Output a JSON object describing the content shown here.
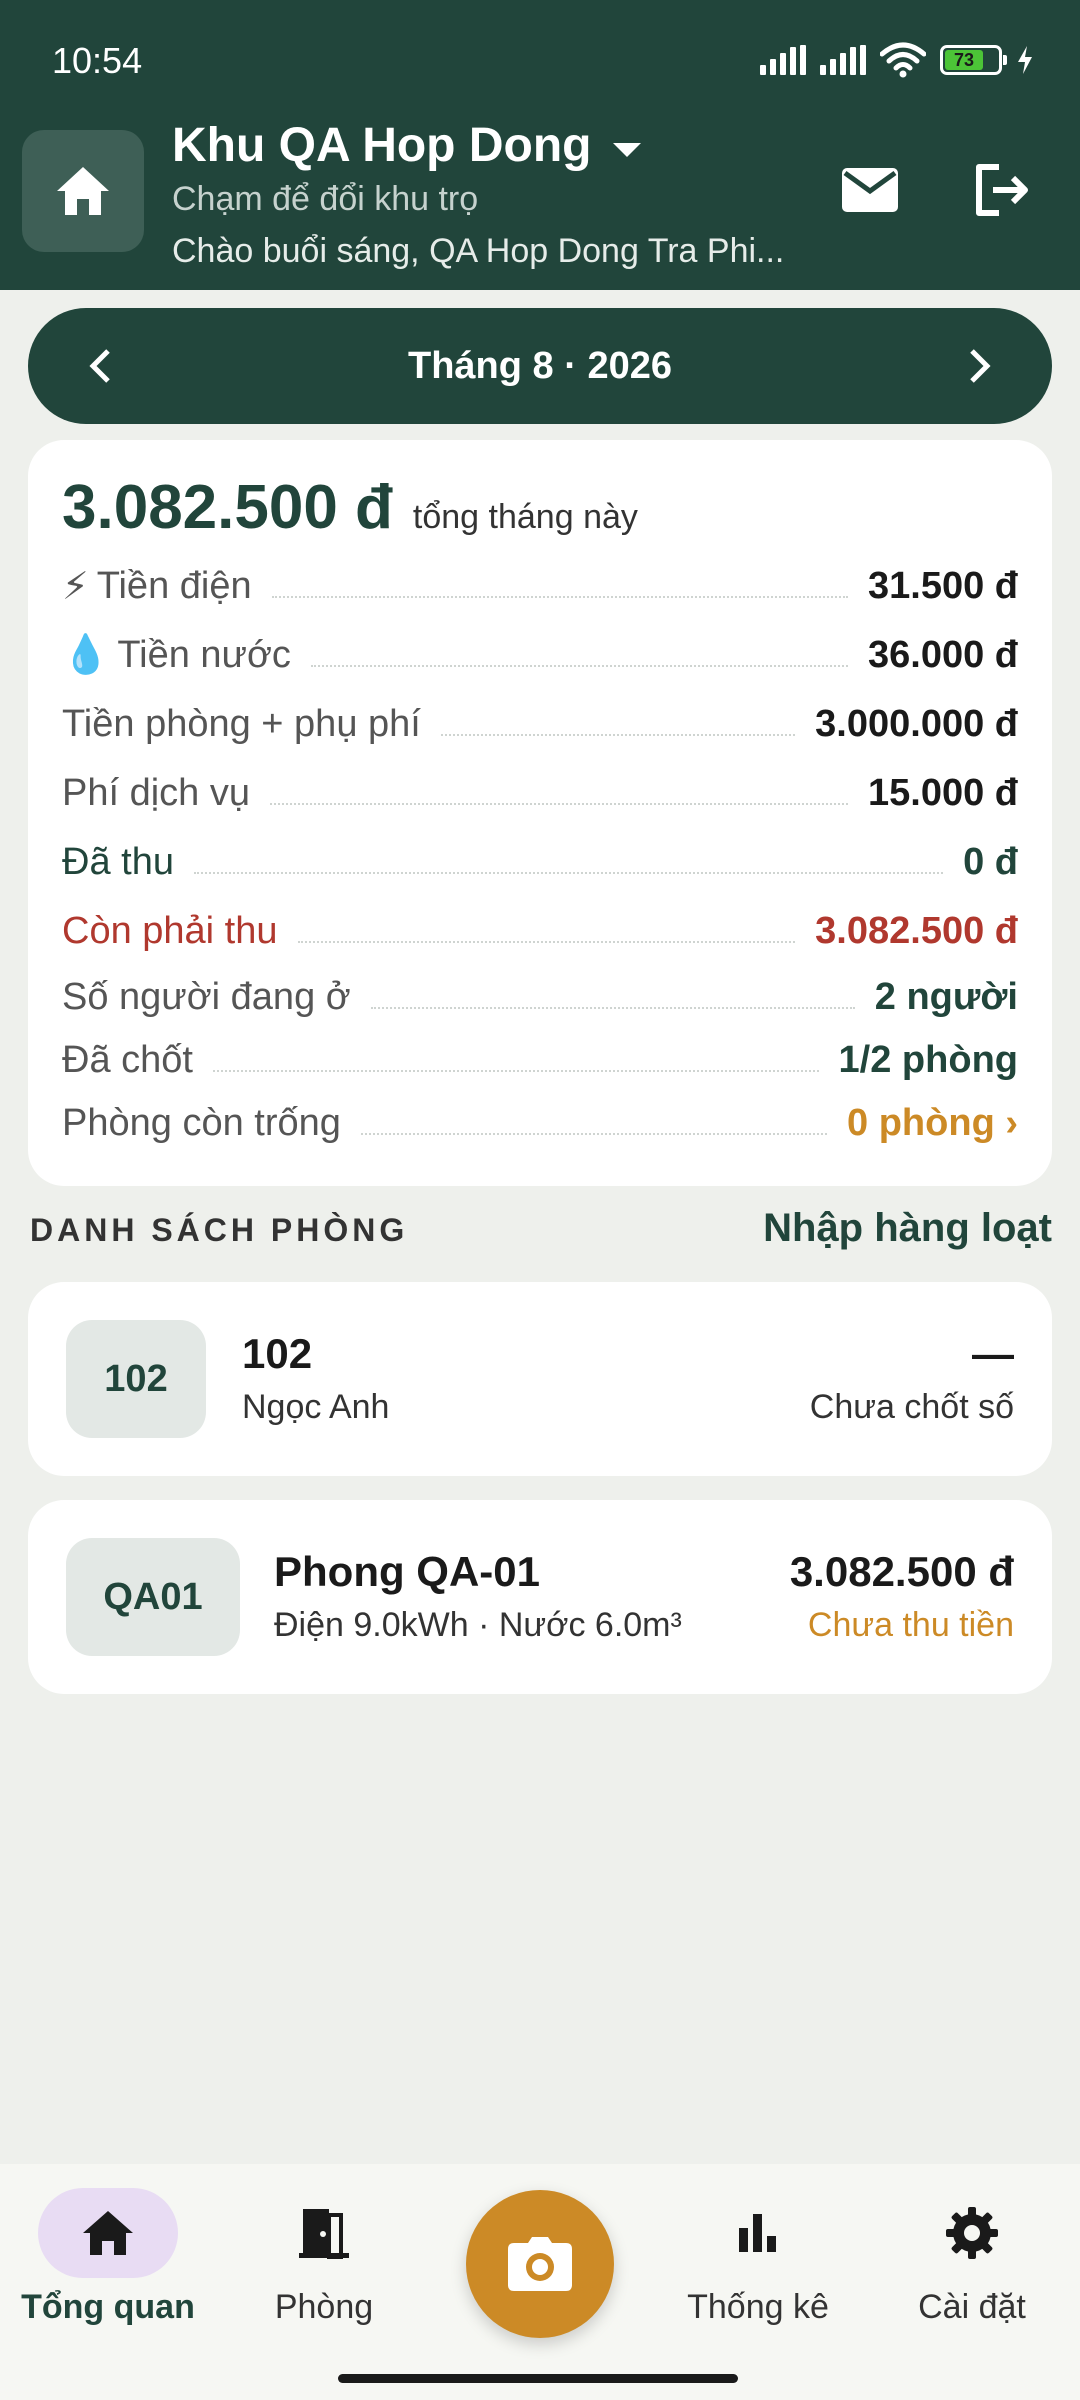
{
  "status_bar": {
    "time": "10:54",
    "battery": "73"
  },
  "header": {
    "title": "Khu QA Hop Dong",
    "subtitle": "Chạm để đổi khu trọ",
    "greeting": "Chào buổi sáng, QA Hop Dong Tra Phi..."
  },
  "month": {
    "label": "Tháng 8 · 2026"
  },
  "summary": {
    "total": "3.082.500 đ",
    "total_caption": "tổng tháng này",
    "rows": [
      {
        "icon": "⚡",
        "label": "Tiền điện",
        "value": "31.500 đ"
      },
      {
        "icon": "💧",
        "label": "Tiền nước",
        "value": "36.000 đ"
      },
      {
        "label": "Tiền phòng + phụ phí",
        "value": "3.000.000 đ"
      },
      {
        "label": "Phí dịch vụ",
        "value": "15.000 đ"
      },
      {
        "label": "Đã thu",
        "value": "0 đ"
      },
      {
        "label": "Còn phải thu",
        "value": "3.082.500 đ"
      },
      {
        "label": "Số người đang ở",
        "value": "2 người"
      },
      {
        "label": "Đã chốt",
        "value": "1/2 phòng"
      },
      {
        "label": "Phòng còn trống",
        "value": "0 phòng ›"
      }
    ]
  },
  "rooms_section": {
    "title": "DANH SÁCH PHÒNG",
    "bulk_action": "Nhập hàng loạt"
  },
  "rooms": [
    {
      "code": "102",
      "name": "102",
      "tenant": "Ngọc Anh",
      "amount": "—",
      "status": "Chưa chốt số"
    },
    {
      "code": "QA01",
      "name": "Phong QA-01",
      "tenant": "Điện 9.0kWh · Nước 6.0m³",
      "amount": "3.082.500 đ",
      "status": "Chưa thu tiền"
    }
  ],
  "nav": {
    "overview": "Tổng quan",
    "rooms": "Phòng",
    "stats": "Thống kê",
    "settings": "Cài đặt"
  },
  "colors": {
    "primary": "#21453b",
    "accent": "#cc8a26",
    "danger": "#b0382e"
  }
}
